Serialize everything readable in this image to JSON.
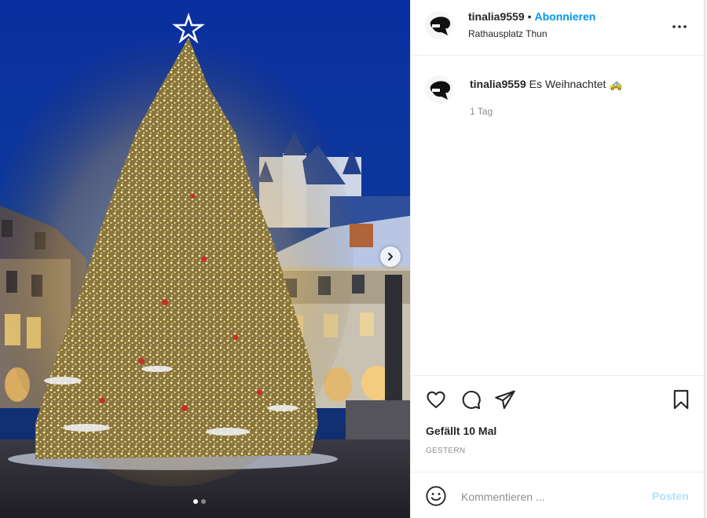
{
  "post": {
    "media": {
      "description_icon": "next-arrow-icon",
      "carousel_count": 2,
      "carousel_active": 1
    },
    "header": {
      "username": "tinalia9559",
      "separator": "•",
      "follow_label": "Abonnieren",
      "location": "Rathausplatz Thun",
      "more_icon": "more-options-icon"
    },
    "caption": {
      "username": "tinalia9559",
      "text": "Es Weihnachtet 🚕",
      "time": "1 Tag"
    },
    "actions": {
      "like_icon": "heart-icon",
      "comment_icon": "comment-icon",
      "share_icon": "share-icon",
      "save_icon": "bookmark-icon"
    },
    "likes": "Gefällt 10 Mal",
    "date": "GESTERN",
    "comment": {
      "emoji_icon": "emoji-icon",
      "placeholder": "Kommentieren ...",
      "submit_label": "Posten"
    },
    "colors": {
      "accent": "#0095f6",
      "accent_disabled": "#b2dffc",
      "sky": "#0b2a6e",
      "tree_lights": "#f2c86a"
    }
  }
}
